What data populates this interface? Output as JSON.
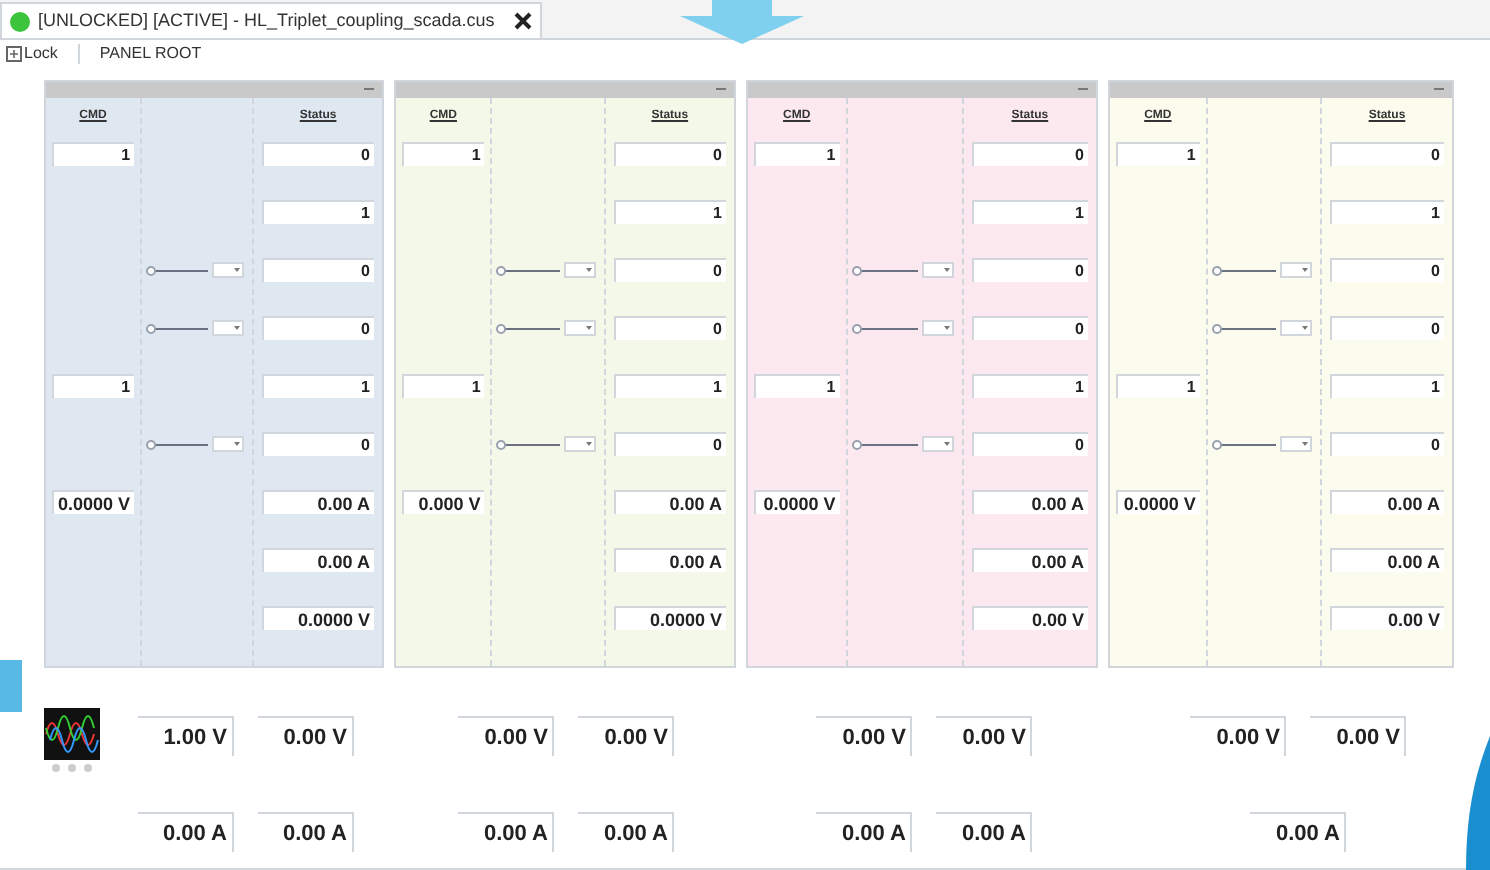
{
  "tab": {
    "title": "[UNLOCKED] [ACTIVE] - HL_Triplet_coupling_scada.cus"
  },
  "toolbar": {
    "lock": "Lock",
    "location": "PANEL ROOT"
  },
  "panels": [
    {
      "color": "#dfe8f1",
      "cmd_heading": "CMD",
      "status_heading": "Status",
      "rows": [
        {
          "cmd": "1",
          "status": "0"
        },
        {
          "status": "1"
        },
        {
          "slider": {
            "level": 0
          },
          "status": "0"
        },
        {
          "slider": {
            "level": 0
          },
          "status": "0"
        },
        {
          "cmd": "1",
          "status": "1"
        },
        {
          "slider": {
            "level": 0
          },
          "status": "0"
        },
        {
          "cmd": "0.0000 V",
          "status": "0.00 A"
        },
        {
          "status": "0.00 A"
        },
        {
          "status": "0.0000 V"
        }
      ]
    },
    {
      "color": "#f4f8e9",
      "cmd_heading": "CMD",
      "status_heading": "Status",
      "rows": [
        {
          "cmd": "1",
          "status": "0"
        },
        {
          "status": "1"
        },
        {
          "slider": {
            "level": 0
          },
          "status": "0"
        },
        {
          "slider": {
            "level": 0
          },
          "status": "0"
        },
        {
          "cmd": "1",
          "status": "1"
        },
        {
          "slider": {
            "level": 0
          },
          "status": "0"
        },
        {
          "cmd": "0.000 V",
          "status": "0.00 A"
        },
        {
          "status": "0.00 A"
        },
        {
          "status": "0.0000 V"
        }
      ]
    },
    {
      "color": "#fbe9ef",
      "cmd_heading": "CMD",
      "status_heading": "Status",
      "rows": [
        {
          "cmd": "1",
          "status": "0"
        },
        {
          "status": "1"
        },
        {
          "slider": {
            "level": 0
          },
          "status": "0"
        },
        {
          "slider": {
            "level": 0
          },
          "status": "0"
        },
        {
          "cmd": "1",
          "status": "1"
        },
        {
          "slider": {
            "level": 0
          },
          "status": "0"
        },
        {
          "cmd": "0.0000 V",
          "status": "0.00 A"
        },
        {
          "status": "0.00 A"
        },
        {
          "status": "0.00 V"
        }
      ]
    },
    {
      "color": "#fbfbee",
      "cmd_heading": "CMD",
      "status_heading": "Status",
      "rows": [
        {
          "cmd": "1",
          "status": "0"
        },
        {
          "status": "1"
        },
        {
          "slider": {
            "level": 0
          },
          "status": "0"
        },
        {
          "slider": {
            "level": 0
          },
          "status": "0"
        },
        {
          "cmd": "1",
          "status": "1"
        },
        {
          "slider": {
            "level": 0
          },
          "status": "0"
        },
        {
          "cmd": "0.0000 V",
          "status": "0.00 A"
        },
        {
          "status": "0.00 A"
        },
        {
          "status": "0.00 V"
        }
      ]
    }
  ],
  "meters": [
    {
      "top": [
        "1.00 V",
        "0.00 V"
      ],
      "bottom": [
        "0.00 A",
        "0.00 A"
      ]
    },
    {
      "top": [
        "0.00 V",
        "0.00 V"
      ],
      "bottom": [
        "0.00 A",
        "0.00 A"
      ]
    },
    {
      "top": [
        "0.00 V",
        "0.00 V"
      ],
      "bottom": [
        "0.00 A",
        "0.00 A"
      ]
    },
    {
      "top": [
        "0.00 V",
        "0.00 V"
      ],
      "bottom": [
        "0.00 A"
      ]
    }
  ]
}
